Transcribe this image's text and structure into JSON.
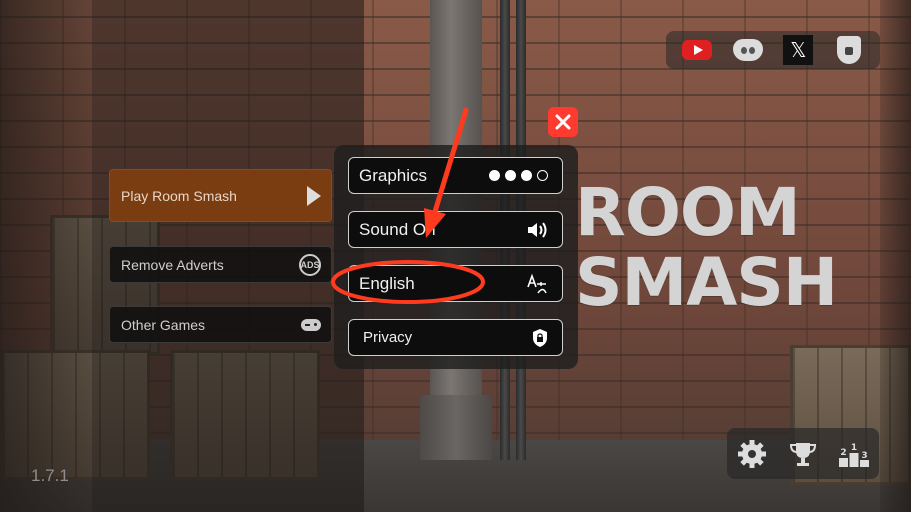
{
  "social": {
    "items": [
      {
        "name": "youtube",
        "icon": "youtube-icon",
        "color": "#e02020"
      },
      {
        "name": "discord",
        "icon": "discord-icon",
        "color": "#dcdcdc"
      },
      {
        "name": "x",
        "icon": "x-icon",
        "label": "𝕏",
        "color": "#111111"
      },
      {
        "name": "privacy-shield",
        "icon": "shield-lock-icon",
        "color": "#dcdcdc"
      }
    ]
  },
  "close_button": {
    "icon": "close-icon",
    "color": "#ff3b30"
  },
  "left_menu": {
    "play_label": "Play Room Smash",
    "remove_ads_label": "Remove Adverts",
    "ads_icon_text": "ADS",
    "other_games_label": "Other Games",
    "play_color": "#7a3d12"
  },
  "settings": {
    "graphics_label": "Graphics",
    "graphics_level": 3,
    "graphics_max": 4,
    "sound_label": "Sound On",
    "language_label": "English",
    "privacy_label": "Privacy"
  },
  "title": {
    "line1": "ROOM",
    "line2": "SMASH"
  },
  "bottom_bar": {
    "items": [
      {
        "name": "settings",
        "icon": "gear-icon"
      },
      {
        "name": "achievements",
        "icon": "trophy-icon"
      },
      {
        "name": "leaderboard",
        "icon": "podium-icon",
        "ranks": [
          "1",
          "2",
          "3"
        ]
      }
    ]
  },
  "version": "1.7.1",
  "annotation_color": "#ff3b1f"
}
